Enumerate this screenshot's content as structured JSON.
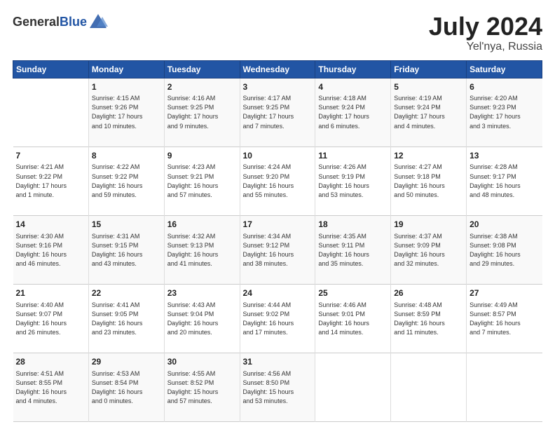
{
  "header": {
    "logo_general": "General",
    "logo_blue": "Blue",
    "month_year": "July 2024",
    "location": "Yel'nya, Russia"
  },
  "weekdays": [
    "Sunday",
    "Monday",
    "Tuesday",
    "Wednesday",
    "Thursday",
    "Friday",
    "Saturday"
  ],
  "weeks": [
    [
      {
        "day": "",
        "content": ""
      },
      {
        "day": "1",
        "content": "Sunrise: 4:15 AM\nSunset: 9:26 PM\nDaylight: 17 hours\nand 10 minutes."
      },
      {
        "day": "2",
        "content": "Sunrise: 4:16 AM\nSunset: 9:25 PM\nDaylight: 17 hours\nand 9 minutes."
      },
      {
        "day": "3",
        "content": "Sunrise: 4:17 AM\nSunset: 9:25 PM\nDaylight: 17 hours\nand 7 minutes."
      },
      {
        "day": "4",
        "content": "Sunrise: 4:18 AM\nSunset: 9:24 PM\nDaylight: 17 hours\nand 6 minutes."
      },
      {
        "day": "5",
        "content": "Sunrise: 4:19 AM\nSunset: 9:24 PM\nDaylight: 17 hours\nand 4 minutes."
      },
      {
        "day": "6",
        "content": "Sunrise: 4:20 AM\nSunset: 9:23 PM\nDaylight: 17 hours\nand 3 minutes."
      }
    ],
    [
      {
        "day": "7",
        "content": "Sunrise: 4:21 AM\nSunset: 9:22 PM\nDaylight: 17 hours\nand 1 minute."
      },
      {
        "day": "8",
        "content": "Sunrise: 4:22 AM\nSunset: 9:22 PM\nDaylight: 16 hours\nand 59 minutes."
      },
      {
        "day": "9",
        "content": "Sunrise: 4:23 AM\nSunset: 9:21 PM\nDaylight: 16 hours\nand 57 minutes."
      },
      {
        "day": "10",
        "content": "Sunrise: 4:24 AM\nSunset: 9:20 PM\nDaylight: 16 hours\nand 55 minutes."
      },
      {
        "day": "11",
        "content": "Sunrise: 4:26 AM\nSunset: 9:19 PM\nDaylight: 16 hours\nand 53 minutes."
      },
      {
        "day": "12",
        "content": "Sunrise: 4:27 AM\nSunset: 9:18 PM\nDaylight: 16 hours\nand 50 minutes."
      },
      {
        "day": "13",
        "content": "Sunrise: 4:28 AM\nSunset: 9:17 PM\nDaylight: 16 hours\nand 48 minutes."
      }
    ],
    [
      {
        "day": "14",
        "content": "Sunrise: 4:30 AM\nSunset: 9:16 PM\nDaylight: 16 hours\nand 46 minutes."
      },
      {
        "day": "15",
        "content": "Sunrise: 4:31 AM\nSunset: 9:15 PM\nDaylight: 16 hours\nand 43 minutes."
      },
      {
        "day": "16",
        "content": "Sunrise: 4:32 AM\nSunset: 9:13 PM\nDaylight: 16 hours\nand 41 minutes."
      },
      {
        "day": "17",
        "content": "Sunrise: 4:34 AM\nSunset: 9:12 PM\nDaylight: 16 hours\nand 38 minutes."
      },
      {
        "day": "18",
        "content": "Sunrise: 4:35 AM\nSunset: 9:11 PM\nDaylight: 16 hours\nand 35 minutes."
      },
      {
        "day": "19",
        "content": "Sunrise: 4:37 AM\nSunset: 9:09 PM\nDaylight: 16 hours\nand 32 minutes."
      },
      {
        "day": "20",
        "content": "Sunrise: 4:38 AM\nSunset: 9:08 PM\nDaylight: 16 hours\nand 29 minutes."
      }
    ],
    [
      {
        "day": "21",
        "content": "Sunrise: 4:40 AM\nSunset: 9:07 PM\nDaylight: 16 hours\nand 26 minutes."
      },
      {
        "day": "22",
        "content": "Sunrise: 4:41 AM\nSunset: 9:05 PM\nDaylight: 16 hours\nand 23 minutes."
      },
      {
        "day": "23",
        "content": "Sunrise: 4:43 AM\nSunset: 9:04 PM\nDaylight: 16 hours\nand 20 minutes."
      },
      {
        "day": "24",
        "content": "Sunrise: 4:44 AM\nSunset: 9:02 PM\nDaylight: 16 hours\nand 17 minutes."
      },
      {
        "day": "25",
        "content": "Sunrise: 4:46 AM\nSunset: 9:01 PM\nDaylight: 16 hours\nand 14 minutes."
      },
      {
        "day": "26",
        "content": "Sunrise: 4:48 AM\nSunset: 8:59 PM\nDaylight: 16 hours\nand 11 minutes."
      },
      {
        "day": "27",
        "content": "Sunrise: 4:49 AM\nSunset: 8:57 PM\nDaylight: 16 hours\nand 7 minutes."
      }
    ],
    [
      {
        "day": "28",
        "content": "Sunrise: 4:51 AM\nSunset: 8:55 PM\nDaylight: 16 hours\nand 4 minutes."
      },
      {
        "day": "29",
        "content": "Sunrise: 4:53 AM\nSunset: 8:54 PM\nDaylight: 16 hours\nand 0 minutes."
      },
      {
        "day": "30",
        "content": "Sunrise: 4:55 AM\nSunset: 8:52 PM\nDaylight: 15 hours\nand 57 minutes."
      },
      {
        "day": "31",
        "content": "Sunrise: 4:56 AM\nSunset: 8:50 PM\nDaylight: 15 hours\nand 53 minutes."
      },
      {
        "day": "",
        "content": ""
      },
      {
        "day": "",
        "content": ""
      },
      {
        "day": "",
        "content": ""
      }
    ]
  ]
}
